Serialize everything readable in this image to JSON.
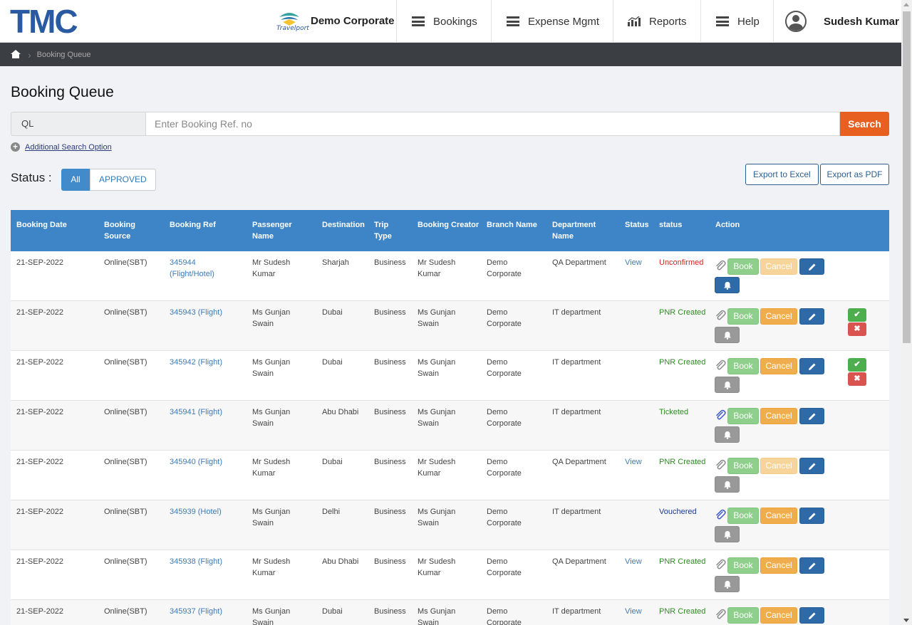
{
  "header": {
    "logo": "TMC",
    "partner_logo_text": "Travelport",
    "corporate": "Demo Corporate",
    "nav": [
      "Bookings",
      "Expense Mgmt",
      "Reports",
      "Help"
    ],
    "user": "Sudesh Kumar"
  },
  "breadcrumb": {
    "current": "Booking Queue"
  },
  "page": {
    "title": "Booking Queue"
  },
  "search": {
    "prefix": "QL",
    "placeholder": "Enter Booking Ref. no",
    "button": "Search",
    "additional": "Additional Search Option"
  },
  "status": {
    "label": "Status :",
    "tabs": [
      "All",
      "APPROVED"
    ]
  },
  "export": {
    "excel": "Export to Excel",
    "pdf": "Export as PDF"
  },
  "table": {
    "headers": [
      "Booking Date",
      "Booking Source",
      "Booking Ref",
      "Passenger Name",
      "Destination",
      "Trip Type",
      "Booking Creator",
      "Branch Name",
      "Department Name",
      "Status",
      "status",
      "Action"
    ],
    "action_labels": {
      "book": "Book",
      "cancel": "Cancel"
    },
    "rows": [
      {
        "date": "21-SEP-2022",
        "source": "Online(SBT)",
        "ref": "345944 (Flight/Hotel)",
        "passenger": "Mr Sudesh Kumar",
        "destination": "Sharjah",
        "trip": "Business",
        "creator": "Mr Sudesh Kumar",
        "branch": "Demo Corporate",
        "department": "QA Department",
        "view": "View",
        "status": "Unconfirmed",
        "status_class": "st-unconfirmed",
        "cancel_disabled": true,
        "bell_active": true,
        "approve": false,
        "clip_blue": false
      },
      {
        "date": "21-SEP-2022",
        "source": "Online(SBT)",
        "ref": "345943 (Flight)",
        "passenger": "Ms Gunjan Swain",
        "destination": "Dubai",
        "trip": "Business",
        "creator": "Ms Gunjan Swain",
        "branch": "Demo Corporate",
        "department": "IT department",
        "view": "",
        "status": "PNR Created",
        "status_class": "st-green",
        "cancel_disabled": false,
        "bell_active": false,
        "approve": true,
        "clip_blue": false
      },
      {
        "date": "21-SEP-2022",
        "source": "Online(SBT)",
        "ref": "345942 (Flight)",
        "passenger": "Ms Gunjan Swain",
        "destination": "Dubai",
        "trip": "Business",
        "creator": "Ms Gunjan Swain",
        "branch": "Demo Corporate",
        "department": "IT department",
        "view": "",
        "status": "PNR Created",
        "status_class": "st-green",
        "cancel_disabled": false,
        "bell_active": false,
        "approve": true,
        "clip_blue": false
      },
      {
        "date": "21-SEP-2022",
        "source": "Online(SBT)",
        "ref": "345941 (Flight)",
        "passenger": "Ms Gunjan Swain",
        "destination": "Abu Dhabi",
        "trip": "Business",
        "creator": "Ms Gunjan Swain",
        "branch": "Demo Corporate",
        "department": "IT department",
        "view": "",
        "status": "Ticketed",
        "status_class": "st-green",
        "cancel_disabled": false,
        "bell_active": false,
        "approve": false,
        "clip_blue": true
      },
      {
        "date": "21-SEP-2022",
        "source": "Online(SBT)",
        "ref": "345940 (Flight)",
        "passenger": "Mr Sudesh Kumar",
        "destination": "Dubai",
        "trip": "Business",
        "creator": "Mr Sudesh Kumar",
        "branch": "Demo Corporate",
        "department": "QA Department",
        "view": "View",
        "status": "PNR Created",
        "status_class": "st-green",
        "cancel_disabled": true,
        "bell_active": false,
        "approve": false,
        "clip_blue": false
      },
      {
        "date": "21-SEP-2022",
        "source": "Online(SBT)",
        "ref": "345939 (Hotel)",
        "passenger": "Ms Gunjan Swain",
        "destination": "Delhi",
        "trip": "Business",
        "creator": "Ms Gunjan Swain",
        "branch": "Demo Corporate",
        "department": "IT department",
        "view": "",
        "status": "Vouchered",
        "status_class": "st-blue",
        "cancel_disabled": false,
        "bell_active": false,
        "approve": false,
        "clip_blue": true
      },
      {
        "date": "21-SEP-2022",
        "source": "Online(SBT)",
        "ref": "345938 (Flight)",
        "passenger": "Mr Sudesh Kumar",
        "destination": "Abu Dhabi",
        "trip": "Business",
        "creator": "Mr Sudesh Kumar",
        "branch": "Demo Corporate",
        "department": "QA Department",
        "view": "View",
        "status": "PNR Created",
        "status_class": "st-green",
        "cancel_disabled": false,
        "bell_active": false,
        "approve": false,
        "clip_blue": false
      },
      {
        "date": "21-SEP-2022",
        "source": "Online(SBT)",
        "ref": "345937 (Flight)",
        "passenger": "Ms Gunjan Swain",
        "destination": "Dubai",
        "trip": "Business",
        "creator": "Ms Gunjan Swain",
        "branch": "Demo Corporate",
        "department": "IT department",
        "view": "View",
        "status": "PNR Created",
        "status_class": "st-green",
        "cancel_disabled": false,
        "bell_active": false,
        "approve": false,
        "clip_blue": false
      }
    ]
  },
  "colors": {
    "brand": "#2a5aa2",
    "header_bar": "#3d85c6",
    "search_button": "#e8601f"
  }
}
